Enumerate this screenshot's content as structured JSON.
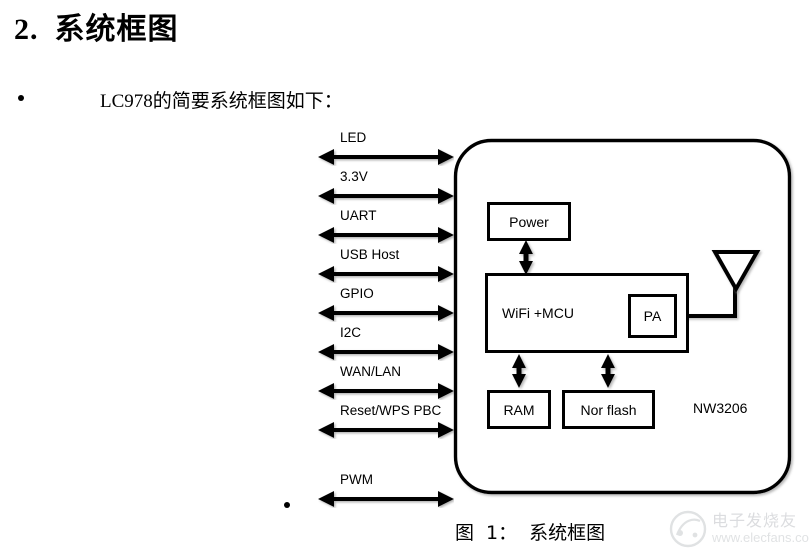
{
  "heading": {
    "number": "2.",
    "title": "系统框图"
  },
  "intro": {
    "bullet_text": "LC978的简要系统框图如下："
  },
  "diagram": {
    "interfaces": [
      {
        "label": "LED"
      },
      {
        "label": "3.3V"
      },
      {
        "label": "UART"
      },
      {
        "label": "USB Host"
      },
      {
        "label": "GPIO"
      },
      {
        "label": "I2C"
      },
      {
        "label": "WAN/LAN"
      },
      {
        "label": "Reset/WPS PBC"
      },
      {
        "label": "PWM"
      }
    ],
    "blocks": {
      "power": "Power",
      "wifi_mcu": "WiFi +MCU",
      "pa": "PA",
      "ram": "RAM",
      "nor_flash": "Nor flash"
    },
    "chip_name": "NW3206",
    "antenna": "antenna-symbol"
  },
  "caption": {
    "prefix": "图",
    "number": "1：",
    "title": "系统框图"
  },
  "watermark": {
    "brand_cn": "电子发烧友",
    "url": "www.elecfans.com"
  },
  "colors": {
    "ink": "#000000",
    "paper": "#ffffff",
    "watermark": "#9aa0a6"
  }
}
